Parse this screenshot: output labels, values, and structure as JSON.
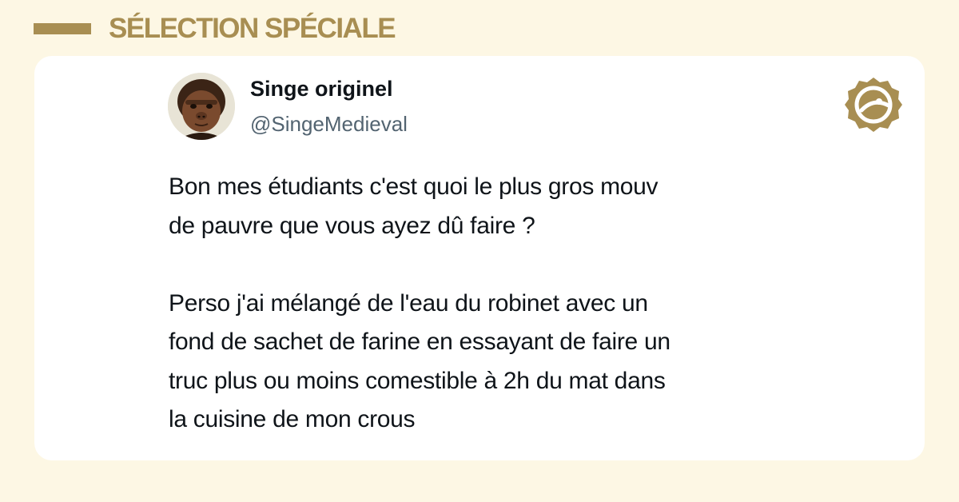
{
  "header": {
    "label": "SÉLECTION SPÉCIALE",
    "accent_color": "#a88e52"
  },
  "post": {
    "author_name": "Singe originel",
    "author_handle": "@SingeMedieval",
    "avatar_icon": "monkey-avatar",
    "brand_icon": "brand-seal-icon",
    "paragraph_1": "Bon mes étudiants c'est quoi le plus gros mouv\nde pauvre que vous ayez dû faire ?",
    "paragraph_2": "Perso j'ai mélangé de l'eau du robinet avec un\nfond de sachet de farine en essayant de faire un\ntruc plus ou moins comestible à 2h du mat dans\nla cuisine de mon crous"
  },
  "colors": {
    "background": "#fdf7e4",
    "card": "#ffffff",
    "text": "#0f1419",
    "handle": "#536471"
  }
}
